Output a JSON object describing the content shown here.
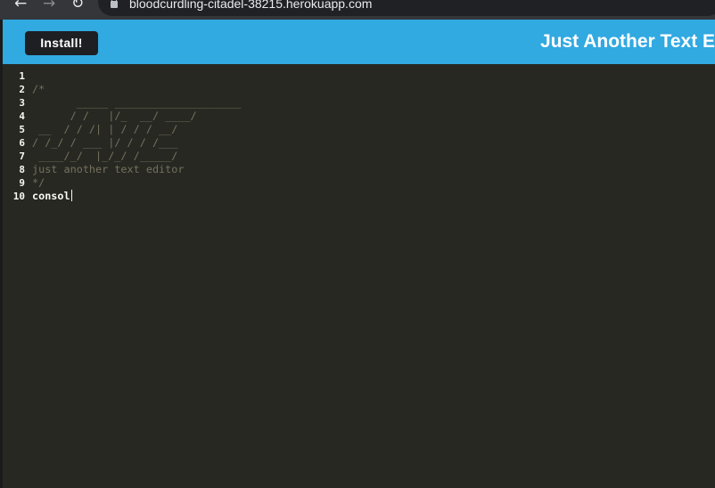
{
  "browser": {
    "url": "bloodcurdling-citadel-38215.herokuapp.com",
    "back_glyph": "←",
    "forward_glyph": "→",
    "reload_glyph": "↻"
  },
  "navbar": {
    "install_label": "Install!",
    "title": "Just Another Text Editor",
    "accent_color": "#31a9e1"
  },
  "editor": {
    "background_color": "#272822",
    "line_numbers": [
      "1",
      "2",
      "3",
      "4",
      "5",
      "6",
      "7",
      "8",
      "9",
      "10"
    ],
    "lines": [
      "",
      "/*",
      "       _____ ____________________",
      "      / /   |/_  __/ ____/",
      " __  / / /| | / / / __/",
      "/ /_/ / ___ |/ / / /___",
      " ____/_/  |_/_/ /_____/",
      "just another text editor",
      "*/",
      "consol"
    ]
  }
}
